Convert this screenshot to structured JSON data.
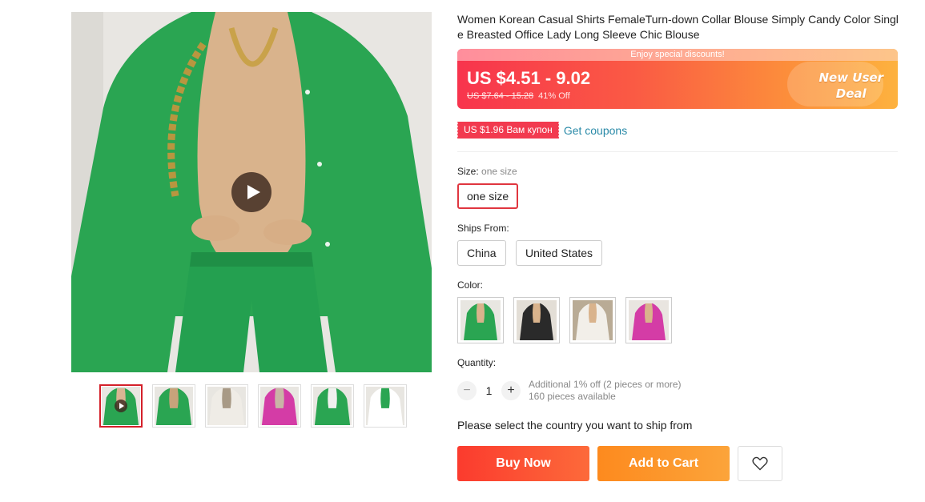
{
  "product": {
    "title": "Women Korean Casual Shirts FemaleTurn-down Collar Blouse Simply Candy Color Single Breasted Office Lady Long Sleeve Chic Blouse"
  },
  "gallery": {
    "thumbnails": [
      {
        "name": "green-video",
        "colors": [
          "#2aa552",
          "#d8b593"
        ]
      },
      {
        "name": "green-sitting",
        "colors": [
          "#2aa552",
          "#c7a37b"
        ]
      },
      {
        "name": "white-shirt",
        "colors": [
          "#efece6",
          "#a89a86"
        ]
      },
      {
        "name": "pink-shirt",
        "colors": [
          "#d43ca6",
          "#c9b4a6"
        ]
      },
      {
        "name": "green-collage",
        "colors": [
          "#2aa552",
          "#f0f0ee"
        ]
      },
      {
        "name": "size-chart",
        "colors": [
          "#ffffff",
          "#2aa552"
        ]
      }
    ],
    "icons": {
      "play": "play-icon"
    }
  },
  "price": {
    "banner_top": "Enjoy special discounts!",
    "current": "US $4.51 - 9.02",
    "original": "US $7.64 - 15.28",
    "discount": "41% Off",
    "deal_line1": "New User",
    "deal_line2": "Deal",
    "colors": {
      "start": "#f8344d",
      "end": "#fdb23f"
    }
  },
  "coupon": {
    "tag": "US $1.96 Вам купон",
    "link": "Get coupons"
  },
  "size": {
    "label": "Size:",
    "selected": "one size",
    "options": [
      "one size"
    ]
  },
  "ships_from": {
    "label": "Ships From:",
    "options": [
      "China",
      "United States"
    ]
  },
  "color": {
    "label": "Color:",
    "swatches": [
      {
        "name": "green",
        "shirt": "#2aa552",
        "bg": "#e8e6e1"
      },
      {
        "name": "black",
        "shirt": "#2a2a2a",
        "bg": "#e3ded6"
      },
      {
        "name": "white",
        "shirt": "#f2efe9",
        "bg": "#b9ab95"
      },
      {
        "name": "pink",
        "shirt": "#d43ca6",
        "bg": "#e9e5e0"
      }
    ]
  },
  "quantity": {
    "label": "Quantity:",
    "value": "1",
    "minus": "−",
    "plus": "+",
    "offer": "Additional 1% off (2 pieces or more)",
    "available": "160 pieces available"
  },
  "ship_note": "Please select the country you want to ship from",
  "actions": {
    "buy_now": "Buy Now",
    "add_to_cart": "Add to Cart",
    "wishlist_icon": "heart-icon"
  }
}
